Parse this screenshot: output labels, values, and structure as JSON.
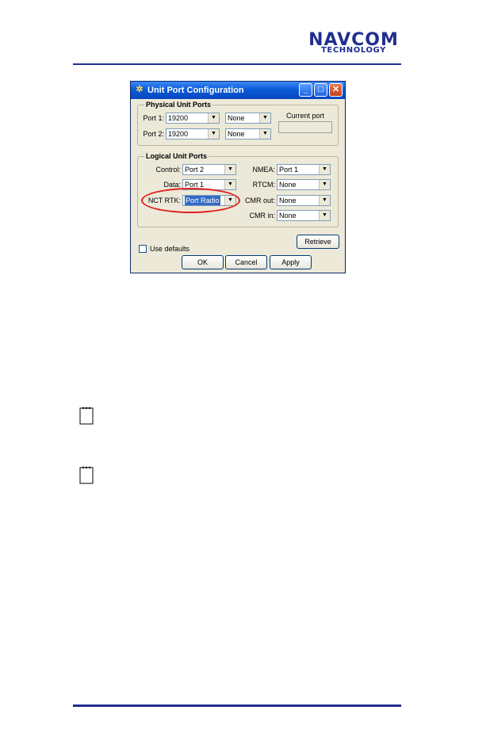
{
  "header": {
    "logo_main": "NAVCOM",
    "logo_sub": "TECHNOLOGY"
  },
  "dialog": {
    "title": "Unit Port Configuration",
    "physical": {
      "group_title": "Physical  Unit Ports",
      "port1_label": "Port 1:",
      "port1_baud": "19200",
      "port1_parity": "None",
      "port2_label": "Port 2:",
      "port2_baud": "19200",
      "port2_parity": "None",
      "current_port_label": "Current port"
    },
    "logical": {
      "group_title": "Logical Unit Ports",
      "control_label": "Control:",
      "control_value": "Port 2",
      "data_label": "Data:",
      "data_value": "Port 1",
      "nctrtk_label": "NCT RTK:",
      "nctrtk_value": "Port Radio",
      "nmea_label": "NMEA:",
      "nmea_value": "Port 1",
      "rtcm_label": "RTCM:",
      "rtcm_value": "None",
      "cmrout_label": "CMR out:",
      "cmrout_value": "None",
      "cmrin_label": "CMR in:",
      "cmrin_value": "None"
    },
    "retrieve_label": "Retrieve",
    "use_defaults_label": "Use defaults",
    "ok_label": "OK",
    "cancel_label": "Cancel",
    "apply_label": "Apply"
  },
  "icons": {
    "title_icon": "satellite-icon",
    "note_icon": "notepad-icon"
  },
  "colors": {
    "brand": "#1f2f8f",
    "highlight": "#e02020"
  }
}
